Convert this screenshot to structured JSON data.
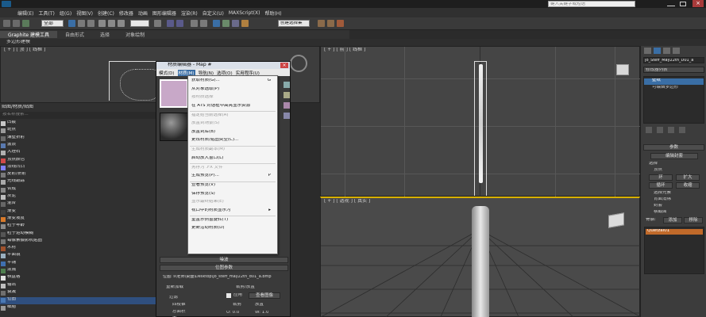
{
  "titlebar": {
    "search_placeholder": "键入关键字或短语"
  },
  "menu": [
    "编辑(E)",
    "工具(T)",
    "组(G)",
    "视图(V)",
    "创建(C)",
    "修改器",
    "动画",
    "图形编辑器",
    "渲染(R)",
    "自定义(U)",
    "MAXScript(X)",
    "帮助(H)"
  ],
  "toolbar": {
    "selection_filter": "全部",
    "named_selection": "创建选择集"
  },
  "ribbon": {
    "tabs": [
      "Graphite 建模工具",
      "自由形式",
      "选择",
      "对象绘制"
    ],
    "sub": "多边形建模"
  },
  "viewports": {
    "top_left": "[ + ] [ 顶 ] [ 线框 ]",
    "top_right": "[ + ] [ 前 ] [ 线框 ]",
    "bottom_right": "[ + ] [ 透视 ] [ 真实 ]"
  },
  "left_panel": {
    "header": "贴图/材质/贴图",
    "search": "按名称搜索...",
    "items": [
      {
        "label": "凹痕",
        "color": "#c8c8c8"
      },
      {
        "label": "斑点",
        "color": "#9a9a9a"
      },
      {
        "label": "薄壁折射",
        "color": "#6a6a6a"
      },
      {
        "label": "波浪",
        "color": "#5a7ab0"
      },
      {
        "label": "大理石",
        "color": "#b0b0b0"
      },
      {
        "label": "顶点颜色",
        "color": "#d04a4a"
      },
      {
        "label": "法线凹凸",
        "color": "#8080ff"
      },
      {
        "label": "反射/折射",
        "color": "#7a7a7a"
      },
      {
        "label": "光线跟踪",
        "color": "#aaaaaa"
      },
      {
        "label": "合成",
        "color": "#888888"
      },
      {
        "label": "灰泥",
        "color": "#bdbdbd"
      },
      {
        "label": "混合",
        "color": "#666666"
      },
      {
        "label": "渐变",
        "color": "#404040"
      },
      {
        "label": "渐变坡度",
        "color": "#d87a2a"
      },
      {
        "label": "粒子年龄",
        "color": "#8a8a8a"
      },
      {
        "label": "粒子运动模糊",
        "color": "#555555"
      },
      {
        "label": "每像素摄影机贴图",
        "color": "#777777"
      },
      {
        "label": "木材",
        "color": "#a0522d"
      },
      {
        "label": "平面镜",
        "color": "#9ab0c0"
      },
      {
        "label": "平铺",
        "color": "#3f6fb0"
      },
      {
        "label": "泼溅",
        "color": "#4f7f4f"
      },
      {
        "label": "棋盘格",
        "color": "#e0e0e0"
      },
      {
        "label": "输出",
        "color": "#c0c0c0"
      },
      {
        "label": "衰减",
        "color": "#6f6f6f"
      },
      {
        "label": "位图",
        "color": "#4a7ab5"
      },
      {
        "label": "细胞",
        "color": "#999999"
      }
    ]
  },
  "material_editor": {
    "title": "材质编辑器 - Map #",
    "menus": [
      "模式(D)",
      "材质(M)",
      "导航(N)",
      "选项(O)",
      "实用程序(U)"
    ],
    "dropdown": [
      {
        "label": "获取材质(G)...",
        "shortcut": "G",
        "enabled": true
      },
      {
        "label": "从对象选取(P)",
        "shortcut": "",
        "enabled": true
      },
      {
        "label": "按材质选择",
        "shortcut": "",
        "enabled": false
      },
      {
        "label": "在 ATS 对话框中高亮显示资源",
        "shortcut": "",
        "enabled": true
      },
      {
        "label": "指定给当前选择(A)",
        "shortcut": "",
        "enabled": false
      },
      {
        "label": "放置到场景(S)",
        "shortcut": "",
        "enabled": false
      },
      {
        "label": "放置到库(B)",
        "shortcut": "",
        "enabled": true
      },
      {
        "label": "更改材质/贴图类型(C)...",
        "shortcut": "",
        "enabled": true
      },
      {
        "label": "生成材质副本(M)",
        "shortcut": "",
        "enabled": false
      },
      {
        "label": "启动放大窗口(L)",
        "shortcut": "",
        "enabled": true
      },
      {
        "label": "另存为 .FX 文件",
        "shortcut": "",
        "enabled": false
      },
      {
        "label": "生成预览(P)...",
        "shortcut": "P",
        "enabled": true
      },
      {
        "label": "查看预览(V)",
        "shortcut": "",
        "enabled": true
      },
      {
        "label": "保存预览(S)",
        "shortcut": "",
        "enabled": true
      },
      {
        "label": "显示最终结果(E)",
        "shortcut": "",
        "enabled": false
      },
      {
        "label": "视口中的材质显示为",
        "shortcut": "▸",
        "enabled": true
      },
      {
        "label": "重置示例窗旋转(T)",
        "shortcut": "",
        "enabled": true
      },
      {
        "label": "更新活动材质(D)",
        "shortcut": "",
        "enabled": true
      }
    ],
    "rollouts": [
      "噪波",
      "位图参数"
    ],
    "bitmap_path": "位图: s\\老师\\桌面\\Desktop\\jo_steff_may22th_d01_a.bmp",
    "reload": "重新加载",
    "crop": "裁剪/放置",
    "apply": "应用",
    "view_image": "查看图像",
    "filter": "过滤",
    "four_corner": "四棱锥",
    "summed": "总面积",
    "none": "无",
    "crop_opt": "裁剪",
    "place_opt": "放置",
    "u_val": "U: 0.0",
    "w_val": "W: 1.0"
  },
  "command_panel": {
    "object_name": "Jo_Steff_May22th_D01_a",
    "modifier_list": "修改器列表",
    "stack": [
      "壁纸",
      "可编辑多边形"
    ],
    "params": "参数",
    "edit_envelope": "编辑封套",
    "select_label": "选择",
    "vertex": "顶点",
    "ring": "环",
    "loop": "循环",
    "grow": "扩大",
    "shrink": "收缩",
    "select_element": "选择元素",
    "backface": "背面消除",
    "envelope": "封套",
    "cross_section": "横截面",
    "bones": "骨骼:",
    "add": "添加",
    "remove": "移除",
    "bone_name": "Quetzal01"
  }
}
